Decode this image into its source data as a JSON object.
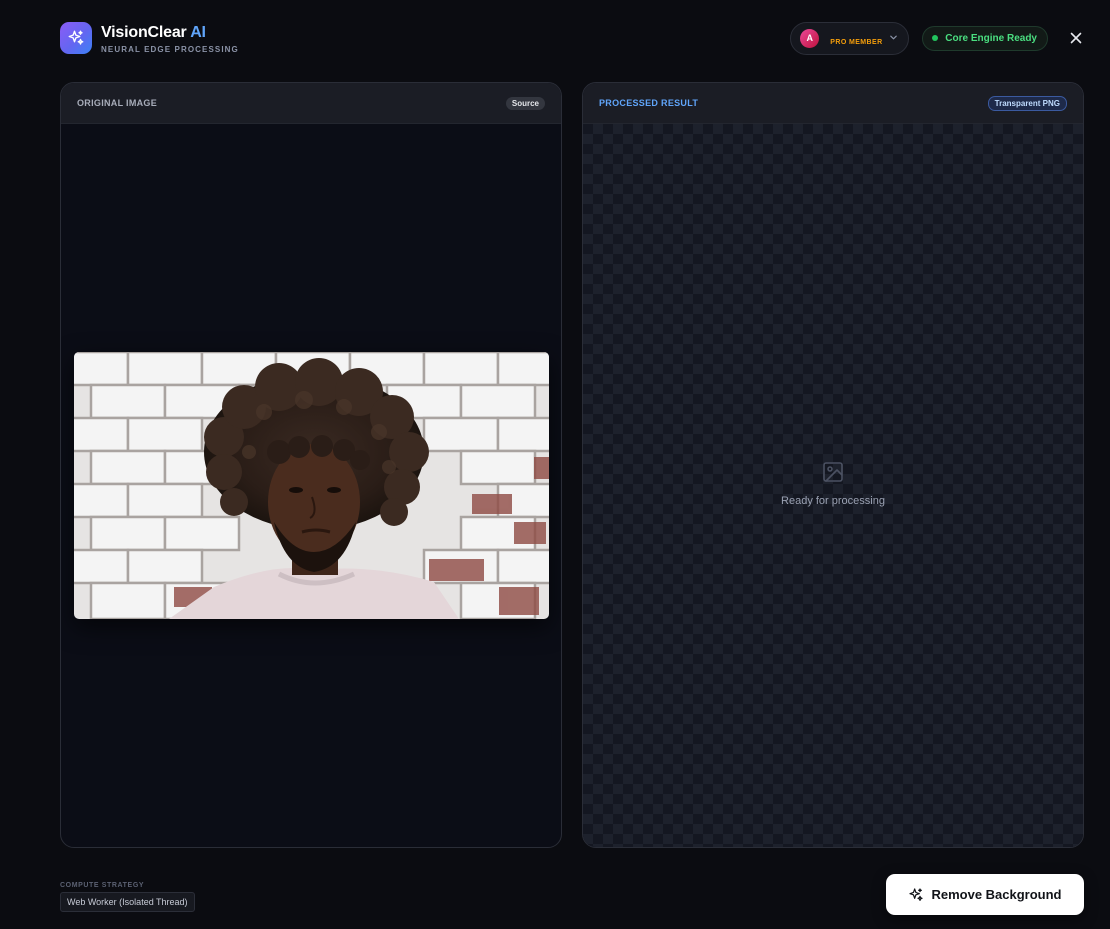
{
  "app": {
    "title_main": "VisionClear",
    "title_accent": "AI",
    "subtitle": "NEURAL EDGE PROCESSING",
    "logo_icon": "sparkles-icon",
    "accent_color": "#60a5fa"
  },
  "user": {
    "avatar_initial": "A",
    "plan": "PRO MEMBER",
    "plan_color": "#f59e0b"
  },
  "status": {
    "text": "Core Engine Ready",
    "color": "#22c55e"
  },
  "panels": {
    "original": {
      "title": "ORIGINAL IMAGE",
      "badge": "Source"
    },
    "processed": {
      "title": "PROCESSED RESULT",
      "badge": "Transparent PNG",
      "empty_text": "Ready for processing",
      "empty_icon": "image-icon"
    }
  },
  "footer": {
    "compute_label": "COMPUTE STRATEGY",
    "compute_value": "Web Worker (Isolated Thread)",
    "action_label": "Remove Background",
    "action_icon": "sparkles-icon"
  }
}
